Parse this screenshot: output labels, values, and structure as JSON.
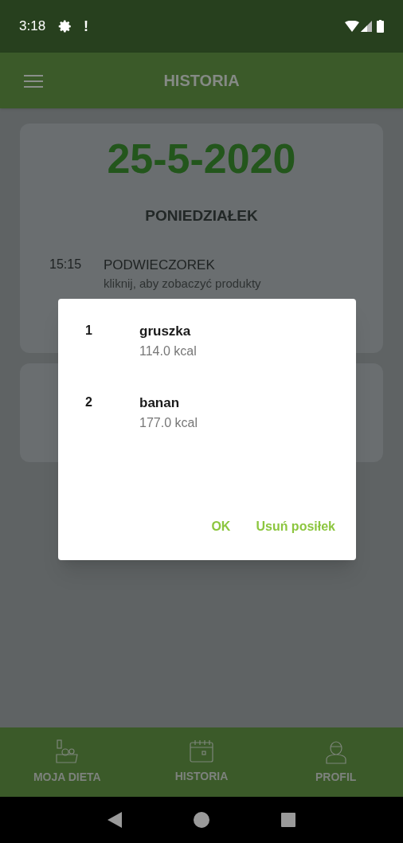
{
  "status_bar": {
    "time": "3:18",
    "notification": "!"
  },
  "app_bar": {
    "title": "HISTORIA"
  },
  "day_card": {
    "date": "25-5-2020",
    "weekday": "PONIEDZIAŁEK",
    "meals": [
      {
        "time": "15:15",
        "name": "PODWIECZOREK",
        "hint": "kliknij, aby zobaczyć produkty"
      }
    ]
  },
  "dialog": {
    "products": [
      {
        "number": "1",
        "name": "gruszka",
        "kcal": "114.0 kcal"
      },
      {
        "number": "2",
        "name": "banan",
        "kcal": "177.0 kcal"
      }
    ],
    "buttons": [
      {
        "label": "OK"
      },
      {
        "label": "Usuń posiłek"
      }
    ]
  },
  "bottom_nav": [
    {
      "label": "MOJA DIETA",
      "kind": "diet"
    },
    {
      "label": "HISTORIA",
      "kind": "calendar"
    },
    {
      "label": "PROFIL",
      "kind": "profile"
    }
  ]
}
